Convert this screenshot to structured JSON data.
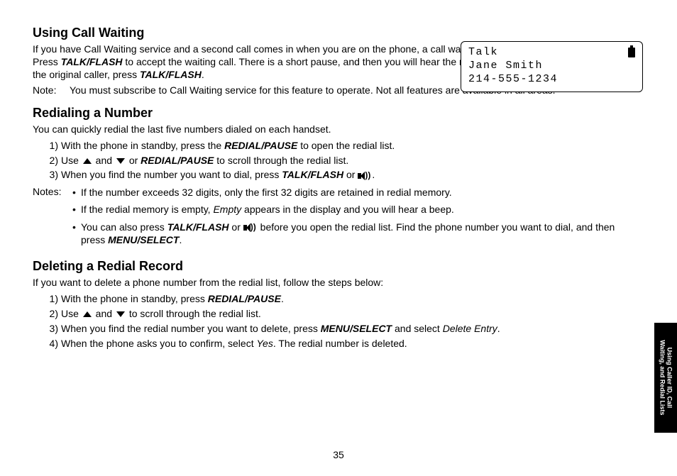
{
  "lcd": {
    "line1": "Talk",
    "line2": "Jane Smith",
    "line3": "214-555-1234"
  },
  "s1": {
    "heading": "Using Call Waiting",
    "p1_a": "If you have Call Waiting service and a second call comes in when you are on the phone, a call waiting tone will sound. Press ",
    "p1_key1": "TALK/FLASH",
    "p1_b": " to accept the waiting call. There is a short pause, and then you will hear the new caller. To return to the original caller, press ",
    "p1_key2": "TALK/FLASH",
    "p1_c": ".",
    "note_label": "Note:",
    "note_body": "You must subscribe to Call Waiting service for this feature to operate. Not all features are available in all areas."
  },
  "s2": {
    "heading": "Redialing a Number",
    "intro": "You can quickly redial the last five numbers dialed on each handset.",
    "li1_a": "With the phone in standby, press the ",
    "li1_key": "REDIAL/PAUSE",
    "li1_b": " to open the redial list.",
    "li2_a": "Use ",
    "li2_mid": " and ",
    "li2_b": " or ",
    "li2_key": "REDIAL/PAUSE",
    "li2_c": " to scroll through the redial list.",
    "li3_a": "When you find the number you want to dial, press ",
    "li3_key": "TALK/FLASH",
    "li3_b": " or ",
    "li3_c": ".",
    "notes_label": "Notes:",
    "n1": "If the number exceeds 32 digits, only the first 32 digits are retained in redial memory.",
    "n2_a": "If the redial memory is empty, ",
    "n2_em": "Empty",
    "n2_b": " appears in the display and you will hear a beep.",
    "n3_a": "You can also press ",
    "n3_key1": "TALK/FLASH",
    "n3_b": " or ",
    "n3_c": " before you open the redial list. Find the phone number you want to dial, and then press ",
    "n3_key2": "MENU/SELECT",
    "n3_d": "."
  },
  "s3": {
    "heading": "Deleting a Redial Record",
    "intro": "If you want to delete a phone number from the redial list, follow the steps below:",
    "li1_a": "With the phone in standby, press ",
    "li1_key": "REDIAL/PAUSE",
    "li1_b": ".",
    "li2_a": "Use ",
    "li2_mid": " and ",
    "li2_b": " to scroll through the redial list.",
    "li3_a": "When you find the redial number you want to delete, press ",
    "li3_key": "MENU/SELECT",
    "li3_b": " and select ",
    "li3_em": "Delete Entry",
    "li3_c": ".",
    "li4_a": "When the phone asks you to confirm, select ",
    "li4_em": "Yes",
    "li4_b": ". The redial number is deleted."
  },
  "sidebar": {
    "line1": "Using Caller ID, Call",
    "line2": "Waiting, and Redial Lists"
  },
  "page_number": "35"
}
